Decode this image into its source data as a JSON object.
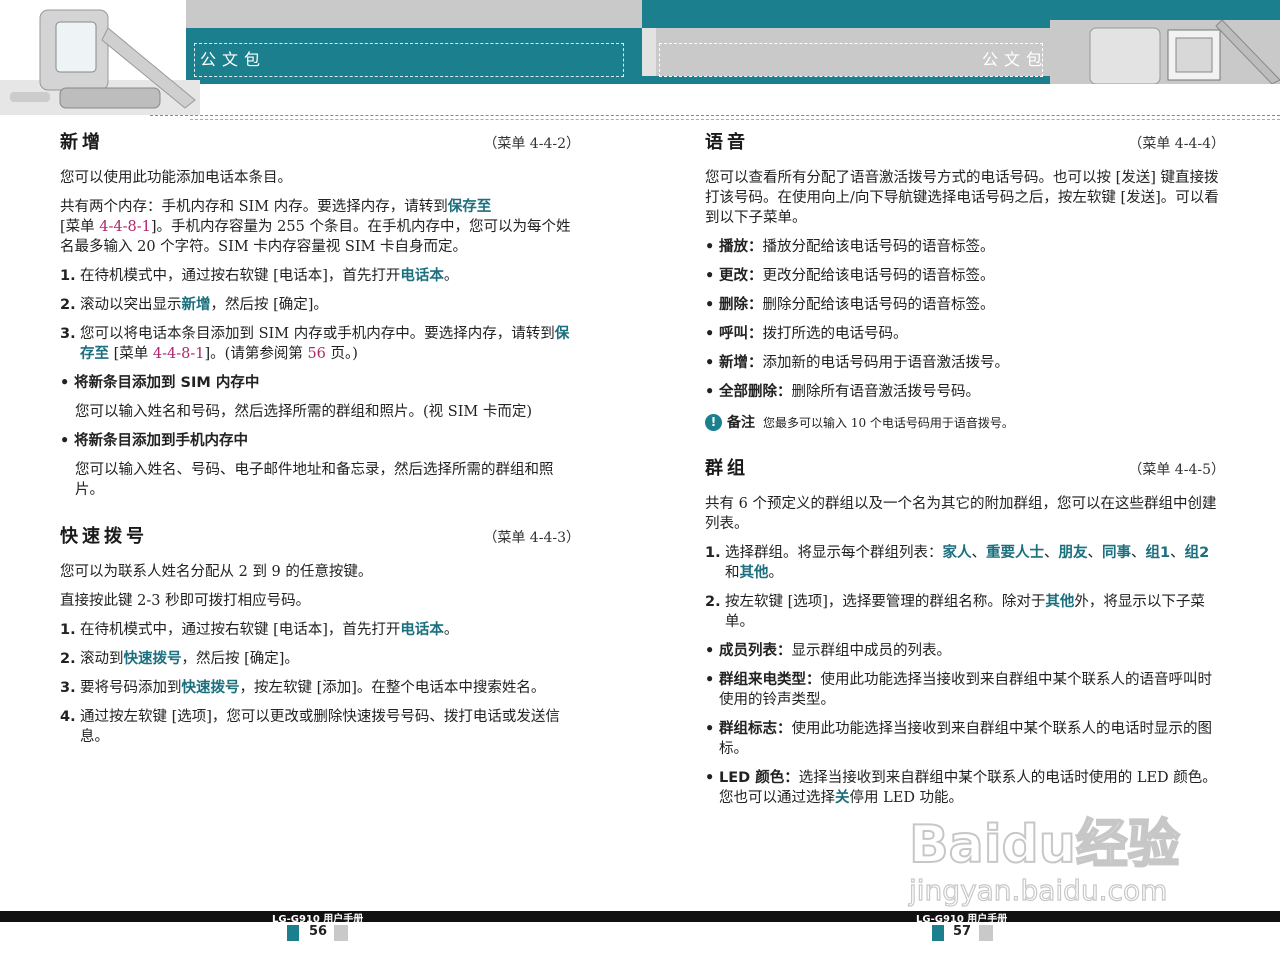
{
  "header": {
    "left_title": "公文包",
    "right_title": "公文包"
  },
  "left": {
    "sections": [
      {
        "title": "新增",
        "menu": "（菜单 4-4-2）",
        "intro": "您可以使用此功能添加电话本条目。",
        "p2": {
          "a": "共有两个内存：手机内存和 SIM 内存。要选择内存，请转到",
          "kw": "保存至",
          "b": "[菜单 ",
          "ref": "4-4-8-1",
          "c": "]。手机内存容量为 255 个条目。在手机内存中，您可以为每个姓名最多输入 20 个字符。SIM 卡内存容量视 SIM 卡自身而定。"
        },
        "steps": [
          {
            "n": "1.",
            "a": "在待机模式中，通过按右软键 [电话本]，首先打开",
            "kw": "电话本",
            "b": "。"
          },
          {
            "n": "2.",
            "a": "滚动以突出显示",
            "kw": "新增",
            "b": "，然后按 [确定]。"
          },
          {
            "n": "3.",
            "a": "您可以将电话本条目添加到 SIM 内存或手机内存中。要选择内存，请转到",
            "kw": "保存至",
            "b": " [菜单 ",
            "ref": "4-4-8-1",
            "c": "]。(请第参阅第 ",
            "page": "56",
            "d": " 页。)"
          }
        ],
        "bullets": [
          {
            "label": "将新条目添加到 SIM 内存中",
            "text": "您可以输入姓名和号码，然后选择所需的群组和照片。(视 SIM 卡而定)"
          },
          {
            "label": "将新条目添加到手机内存中",
            "text": "您可以输入姓名、号码、电子邮件地址和备忘录，然后选择所需的群组和照片。"
          }
        ]
      },
      {
        "title": "快速拨号",
        "menu": "（菜单 4-4-3）",
        "p1": "您可以为联系人姓名分配从 2 到 9 的任意按键。",
        "p2": "直接按此键 2-3 秒即可拨打相应号码。",
        "steps": [
          {
            "n": "1.",
            "a": "在待机模式中，通过按右软键 [电话本]，首先打开",
            "kw": "电话本",
            "b": "。"
          },
          {
            "n": "2.",
            "a": "滚动到",
            "kw": "快速拨号",
            "b": "，然后按 [确定]。"
          },
          {
            "n": "3.",
            "a": "要将号码添加到",
            "kw": "快速拨号",
            "b": "，按左软键 [添加]。在整个电话本中搜索姓名。"
          },
          {
            "n": "4.",
            "a": "通过按左软键 [选项]，您可以更改或删除快速拨号号码、拨打电话或发送信息。"
          }
        ]
      }
    ]
  },
  "right": {
    "voice": {
      "title": "语音",
      "menu": "（菜单 4-4-4）",
      "intro": "您可以查看所有分配了语音激活拨号方式的电话号码。也可以按 [发送] 键直接拨打该号码。在使用向上/向下导航键选择电话号码之后，按左软键 [发送]。可以看到以下子菜单。",
      "items": [
        {
          "label": "播放：",
          "text": "播放分配给该电话号码的语音标签。"
        },
        {
          "label": "更改：",
          "text": "更改分配给该电话号码的语音标签。"
        },
        {
          "label": "删除：",
          "text": "删除分配给该电话号码的语音标签。"
        },
        {
          "label": "呼叫：",
          "text": "拨打所选的电话号码。"
        },
        {
          "label": "新增：",
          "text": "添加新的电话号码用于语音激活拨号。"
        },
        {
          "label": "全部删除：",
          "text": "删除所有语音激活拨号号码。"
        }
      ],
      "note_icon": "!",
      "note_label": "备注",
      "note_text": "您最多可以输入 10 个电话号码用于语音拨号。"
    },
    "group": {
      "title": "群组",
      "menu": "（菜单 4-4-5）",
      "intro": "共有 6 个预定义的群组以及一个名为其它的附加群组，您可以在这些群组中创建列表。",
      "step1": {
        "n": "1.",
        "a": "选择群组。将显示每个群组列表：",
        "k1": "家人",
        "s1": "、",
        "k2": "重要人士",
        "s2": "、",
        "k3": "朋友",
        "s3": "、",
        "k4": "同事",
        "s4": "、",
        "k5": "组1",
        "s5": "、",
        "k6": "组2",
        "s6": " 和",
        "k7": "其他",
        "end": "。"
      },
      "step2": {
        "n": "2.",
        "a": "按左软键 [选项]，选择要管理的群组名称。除对于",
        "kw": "其他",
        "b": "外，将显示以下子菜单。"
      },
      "items": [
        {
          "label": "成员列表：",
          "text": "显示群组中成员的列表。"
        },
        {
          "label": "群组来电类型：",
          "text": "使用此功能选择当接收到来自群组中某个联系人的语音呼叫时使用的铃声类型。"
        },
        {
          "label": "群组标志：",
          "text": "使用此功能选择当接收到来自群组中某个联系人的电话时显示的图标。"
        }
      ],
      "led": {
        "label": "LED 颜色：",
        "a": "选择当接收到来自群组中某个联系人的电话时使用的 LED 颜色。您也可以通过选择",
        "kw": "关",
        "b": "停用 LED 功能。"
      }
    }
  },
  "footer": {
    "model_left": "LG-G910 用户手册",
    "model_right": "LG-G910 用户手册",
    "page_left": "56",
    "page_right": "57"
  },
  "watermark": {
    "brand": "Baidu经验",
    "url": "jingyan.baidu.com"
  }
}
